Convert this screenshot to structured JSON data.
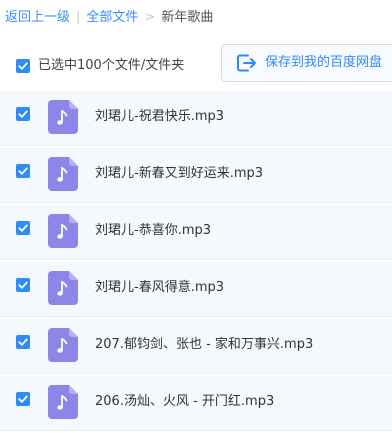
{
  "breadcrumb": {
    "back": "返回上一级",
    "separator": "|",
    "all_files": "全部文件",
    "arrow": ">",
    "current": "新年歌曲"
  },
  "toolbar": {
    "selection_label": "已选中100个文件/文件夹",
    "save_button_label": "保存到我的百度网盘",
    "save_button_icon": "save-to-drive-icon"
  },
  "files": [
    {
      "name": "刘珺儿-祝君快乐.mp3",
      "icon": "music-file-icon",
      "checked": true
    },
    {
      "name": "刘珺儿-新春又到好运来.mp3",
      "icon": "music-file-icon",
      "checked": true
    },
    {
      "name": "刘珺儿-恭喜你.mp3",
      "icon": "music-file-icon",
      "checked": true
    },
    {
      "name": "刘珺儿-春风得意.mp3",
      "icon": "music-file-icon",
      "checked": true
    },
    {
      "name": "207.郁钧剑、张也 - 家和万事兴.mp3",
      "icon": "music-file-icon",
      "checked": true
    },
    {
      "name": "206.汤灿、火风 - 开门红.mp3",
      "icon": "music-file-icon",
      "checked": true
    }
  ],
  "colors": {
    "accent": "#2f8bf5",
    "link": "#3b8cff",
    "file_icon": "#8b86e8",
    "row_background": "#f5f8fd"
  }
}
